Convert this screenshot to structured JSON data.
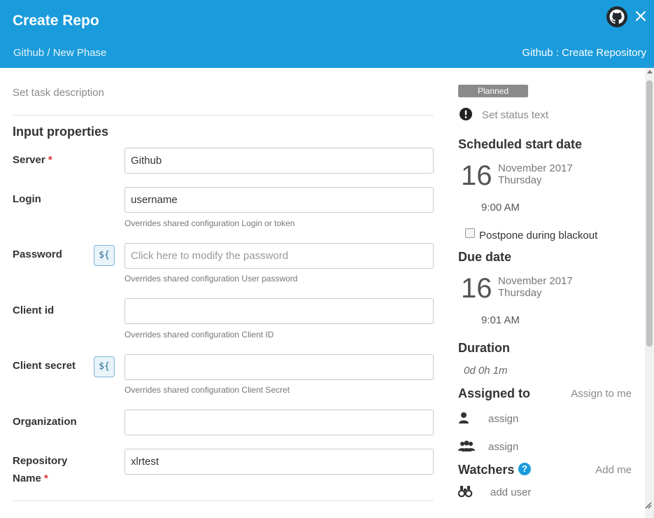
{
  "header": {
    "title": "Create Repo",
    "breadcrumb": "Github / New Phase",
    "task_type": "Github : Create Repository"
  },
  "form": {
    "description_placeholder": "Set task description",
    "section_title": "Input properties",
    "fields": {
      "server": {
        "label": "Server",
        "required": "*",
        "value": "Github"
      },
      "login": {
        "label": "Login",
        "value": "username",
        "help": "Overrides shared configuration Login or token"
      },
      "password": {
        "label": "Password",
        "var_button": "${",
        "placeholder": "Click here to modify the password",
        "help": "Overrides shared configuration User password"
      },
      "client_id": {
        "label": "Client id",
        "value": "",
        "help": "Overrides shared configuration Client ID"
      },
      "client_secret": {
        "label": "Client secret",
        "var_button": "${",
        "value": "",
        "help": "Overrides shared configuration Client Secret"
      },
      "organization": {
        "label": "Organization",
        "value": ""
      },
      "repository_name": {
        "label_line1": "Repository",
        "label_line2": "Name",
        "required": "*",
        "value": "xlrtest"
      }
    }
  },
  "side": {
    "status_badge": "Planned",
    "status_text": "Set status text",
    "scheduled_start": {
      "title": "Scheduled start date",
      "day": "16",
      "month_year": "November 2017",
      "weekday": "Thursday",
      "time": "9:00 AM"
    },
    "postpone_label": "Postpone during blackout",
    "postpone_checked": false,
    "due": {
      "title": "Due date",
      "day": "16",
      "month_year": "November 2017",
      "weekday": "Thursday",
      "time": "9:01 AM"
    },
    "duration": {
      "title": "Duration",
      "value": "0d 0h 1m"
    },
    "assigned": {
      "title": "Assigned to",
      "assign_to_me": "Assign to me",
      "user_assign": "assign",
      "team_assign": "assign"
    },
    "watchers": {
      "title": "Watchers",
      "help": "?",
      "add_me": "Add me",
      "add_user": "add user"
    }
  },
  "colors": {
    "header_bg": "#1a9bdb",
    "badge_bg": "#8a8a8a",
    "required": "#d9302c"
  },
  "icons": {
    "github": "github-icon",
    "close": "close-icon",
    "status": "exclamation-circle-icon",
    "user": "user-icon",
    "team": "users-icon",
    "watchers": "binoculars-icon",
    "help": "question-circle-icon"
  }
}
